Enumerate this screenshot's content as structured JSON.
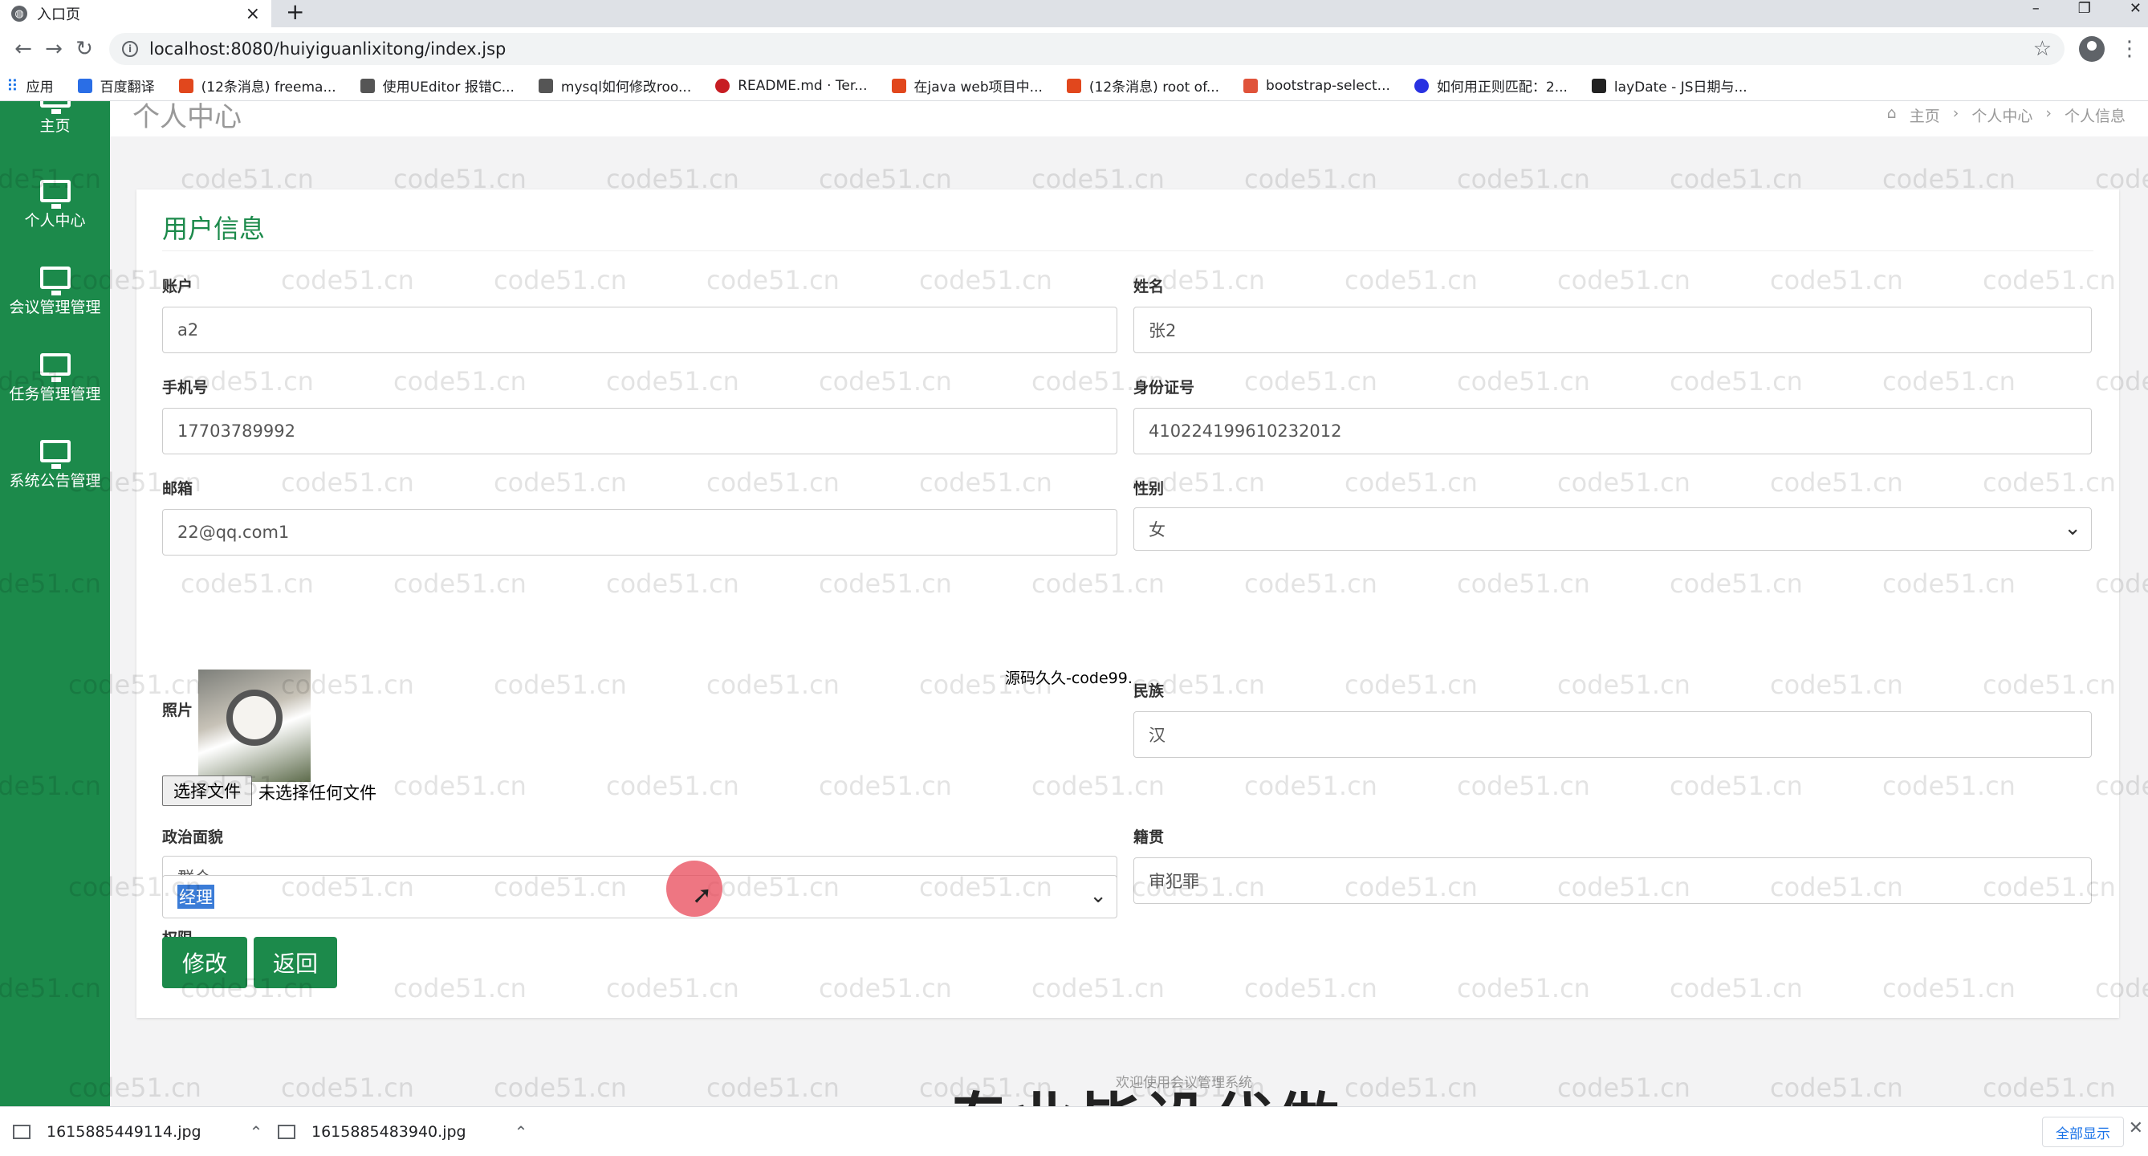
{
  "browser": {
    "tab_title": "入口页",
    "url": "localhost:8080/huiyiguanlixitong/index.jsp",
    "bookmarks": [
      "应用",
      "百度翻译",
      "(12条消息) freema...",
      "使用UEditor 报错C...",
      "mysql如何修改roo...",
      "README.md · Ter...",
      "在java web项目中...",
      "(12条消息) root of...",
      "bootstrap-select...",
      "如何用正则匹配：2...",
      "layDate - JS日期与..."
    ]
  },
  "sidebar": {
    "items": [
      {
        "label": "主页"
      },
      {
        "label": "个人中心"
      },
      {
        "label": "会议管理管理"
      },
      {
        "label": "任务管理管理"
      },
      {
        "label": "系统公告管理"
      }
    ]
  },
  "header": {
    "page_title": "个人中心",
    "breadcrumbs": [
      "主页",
      "个人中心",
      "个人信息"
    ]
  },
  "form": {
    "title": "用户信息",
    "account": {
      "label": "账户",
      "value": "a2"
    },
    "name": {
      "label": "姓名",
      "value": "张2"
    },
    "phone": {
      "label": "手机号",
      "value": "17703789992"
    },
    "id_number": {
      "label": "身份证号",
      "value": "410224199610232012"
    },
    "email": {
      "label": "邮箱",
      "value": "22@qq.com1"
    },
    "gender": {
      "label": "性别",
      "value": "女"
    },
    "photo": {
      "label": "照片",
      "choose_button": "选择文件",
      "status": "未选择任何文件"
    },
    "side_note": "源码久久-code99.",
    "ethnicity": {
      "label": "民族",
      "value": "汉"
    },
    "political": {
      "label": "政治面貌",
      "value": "群众"
    },
    "native_place": {
      "label": "籍贯",
      "value": "审犯罪"
    },
    "permission": {
      "label": "权限",
      "value": "经理"
    },
    "edit_button": "修改",
    "back_button": "返回"
  },
  "footer": {
    "text": "欢迎使用会议管理系统"
  },
  "watermark": "code51.cn",
  "overlay_caption": "专业毕设代做",
  "downloads": {
    "items": [
      "1615885449114.jpg",
      "1615885483940.jpg"
    ],
    "show_all": "全部显示"
  },
  "colors": {
    "primary": "#1c8a4b",
    "selection": "#3b7cd7",
    "cursor": "#e84858"
  }
}
